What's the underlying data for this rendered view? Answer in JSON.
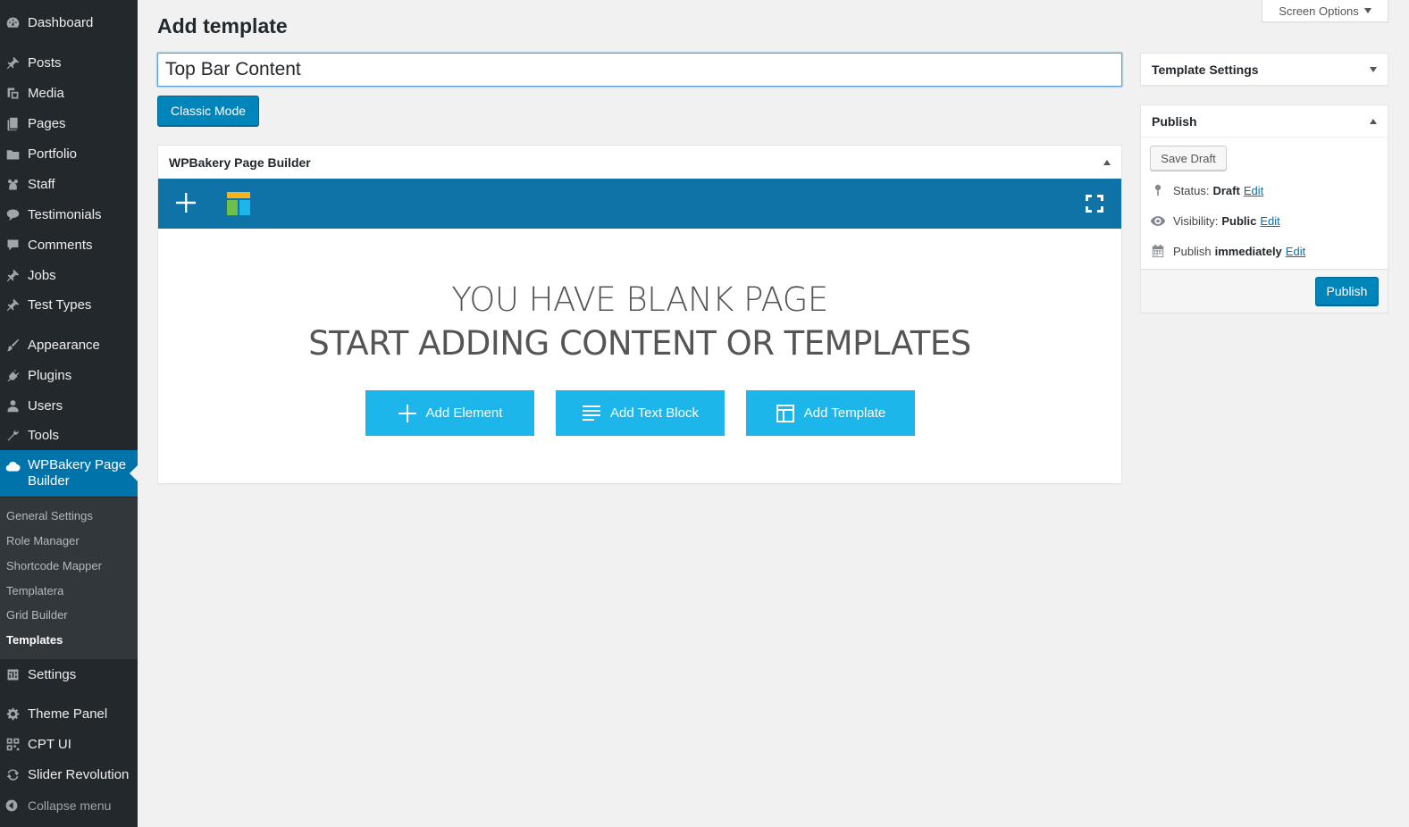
{
  "sidebar": {
    "items": [
      {
        "label": "Dashboard",
        "icon": "dashboard-icon"
      },
      {
        "label": "Posts",
        "icon": "pin-icon"
      },
      {
        "label": "Media",
        "icon": "media-icon"
      },
      {
        "label": "Pages",
        "icon": "pages-icon"
      },
      {
        "label": "Portfolio",
        "icon": "folder-icon"
      },
      {
        "label": "Staff",
        "icon": "staff-icon"
      },
      {
        "label": "Testimonials",
        "icon": "speech-bubble-icon"
      },
      {
        "label": "Comments",
        "icon": "comment-icon"
      },
      {
        "label": "Jobs",
        "icon": "pin-icon"
      },
      {
        "label": "Test Types",
        "icon": "pin-icon"
      },
      {
        "label": "Appearance",
        "icon": "brush-icon"
      },
      {
        "label": "Plugins",
        "icon": "plug-icon"
      },
      {
        "label": "Users",
        "icon": "user-icon"
      },
      {
        "label": "Tools",
        "icon": "wrench-icon"
      },
      {
        "label": "WPBakery Page Builder",
        "icon": "cloud-icon"
      },
      {
        "label": "Settings",
        "icon": "settings-icon"
      },
      {
        "label": "Theme Panel",
        "icon": "gear-icon"
      },
      {
        "label": "CPT UI",
        "icon": "grid-icon"
      },
      {
        "label": "Slider Revolution",
        "icon": "refresh-icon"
      }
    ],
    "submenu": [
      "General Settings",
      "Role Manager",
      "Shortcode Mapper",
      "Templatera",
      "Grid Builder",
      "Templates"
    ],
    "collapse_label": "Collapse menu"
  },
  "screen_options": "Screen Options",
  "page_title": "Add template",
  "title_value": "Top Bar Content",
  "classic_mode_label": "Classic Mode",
  "builder": {
    "title": "WPBakery Page Builder",
    "blank_line1": "YOU HAVE BLANK PAGE",
    "blank_line2": "START ADDING CONTENT OR TEMPLATES",
    "add_element": "Add Element",
    "add_text_block": "Add Text Block",
    "add_template": "Add Template"
  },
  "template_settings": {
    "title": "Template Settings"
  },
  "publish": {
    "title": "Publish",
    "save_draft": "Save Draft",
    "status_label": "Status:",
    "status_value": "Draft",
    "visibility_label": "Visibility:",
    "visibility_value": "Public",
    "publish_label": "Publish",
    "publish_value": "immediately",
    "edit": "Edit",
    "publish_button": "Publish"
  },
  "colors": {
    "accent": "#0073aa",
    "toolbar": "#0f73a8",
    "builder_button": "#1db6eb",
    "sidebar": "#23282d"
  }
}
